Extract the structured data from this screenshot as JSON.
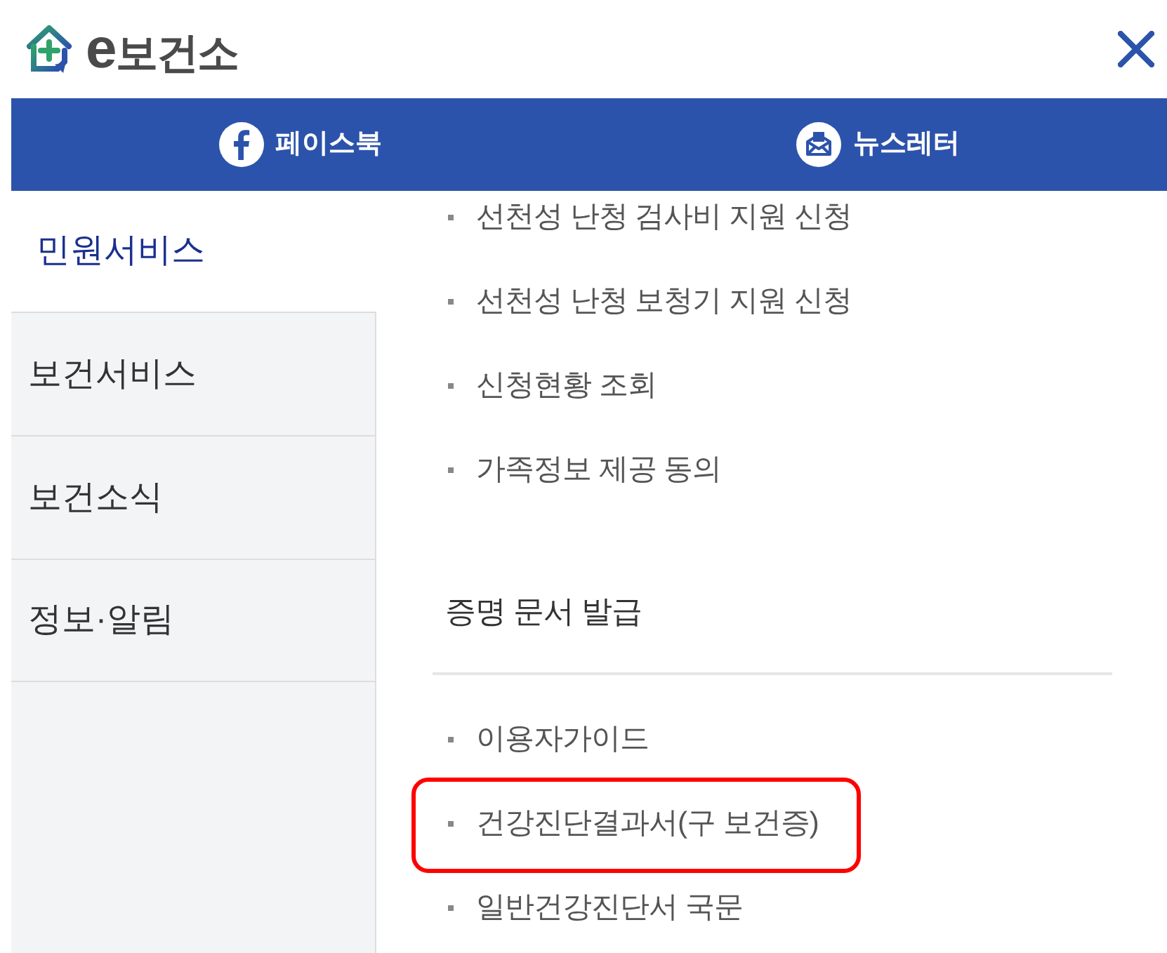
{
  "header": {
    "logo_text": "e보건소"
  },
  "social_bar": [
    {
      "kind": "facebook",
      "label": "페이스북"
    },
    {
      "kind": "newsletter",
      "label": "뉴스레터"
    }
  ],
  "sidebar": {
    "items": [
      {
        "label": "민원서비스",
        "selected": true
      },
      {
        "label": "보건서비스",
        "selected": false
      },
      {
        "label": "보건소식",
        "selected": false
      },
      {
        "label": "정보·알림",
        "selected": false
      }
    ]
  },
  "content": {
    "items": [
      {
        "kind": "link",
        "label": "선천성 난청 검사비 지원 신청",
        "highlighted": false
      },
      {
        "kind": "link",
        "label": "선천성 난청 보청기 지원 신청",
        "highlighted": false
      },
      {
        "kind": "link",
        "label": "신청현황 조회",
        "highlighted": false
      },
      {
        "kind": "link",
        "label": "가족정보 제공 동의",
        "highlighted": false
      },
      {
        "kind": "heading",
        "label": "증명 문서 발급"
      },
      {
        "kind": "link",
        "label": "이용자가이드",
        "highlighted": false
      },
      {
        "kind": "link",
        "label": "건강진단결과서(구 보건증)",
        "highlighted": true
      },
      {
        "kind": "link",
        "label": "일반건강진단서 국문",
        "highlighted": false
      }
    ]
  }
}
